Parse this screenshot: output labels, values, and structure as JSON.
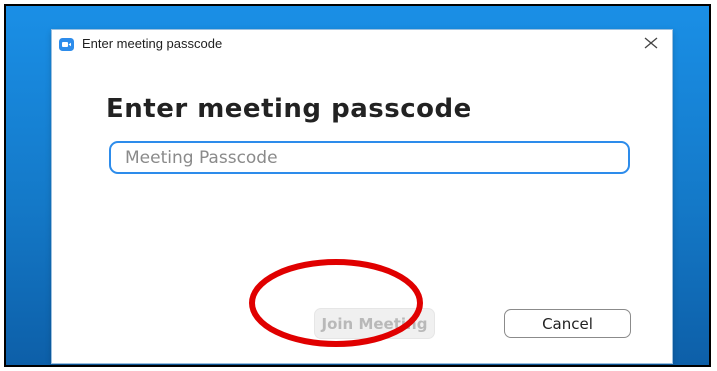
{
  "window": {
    "title": "Enter meeting passcode",
    "app_icon": "zoom-camera-icon",
    "close_icon": "close-icon"
  },
  "dialog": {
    "heading": "Enter meeting passcode",
    "passcode_input": {
      "placeholder": "Meeting Passcode",
      "value": ""
    },
    "join_button_label": "Join Meeting",
    "join_button_enabled": false,
    "cancel_button_label": "Cancel"
  },
  "annotation": {
    "shape": "ellipse",
    "color": "#e00000",
    "target": "join-meeting-button"
  },
  "colors": {
    "accent": "#2d8ceb",
    "desktop_background": "#1479c8",
    "annotation_red": "#e00000"
  }
}
